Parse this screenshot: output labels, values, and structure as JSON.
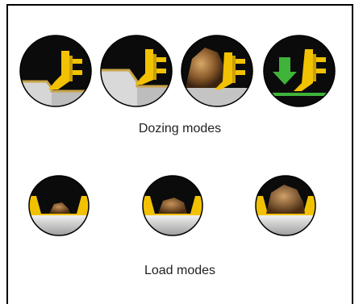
{
  "dozing_section": {
    "caption": "Dozing modes",
    "modes": [
      {
        "icon": "dozing-mode-1-icon"
      },
      {
        "icon": "dozing-mode-2-icon"
      },
      {
        "icon": "dozing-mode-rock-icon"
      },
      {
        "icon": "dozing-mode-arrow-icon"
      }
    ]
  },
  "load_section": {
    "caption": "Load modes",
    "modes": [
      {
        "icon": "load-mode-small-icon"
      },
      {
        "icon": "load-mode-medium-icon"
      },
      {
        "icon": "load-mode-large-icon"
      }
    ]
  },
  "colors": {
    "blade_yellow": "#f2c200",
    "circle_black": "#0b0b0b",
    "ground_grey": "#b8b8b8",
    "arrow_green": "#3fb33a",
    "rock_brown": "#8a5a2b"
  }
}
